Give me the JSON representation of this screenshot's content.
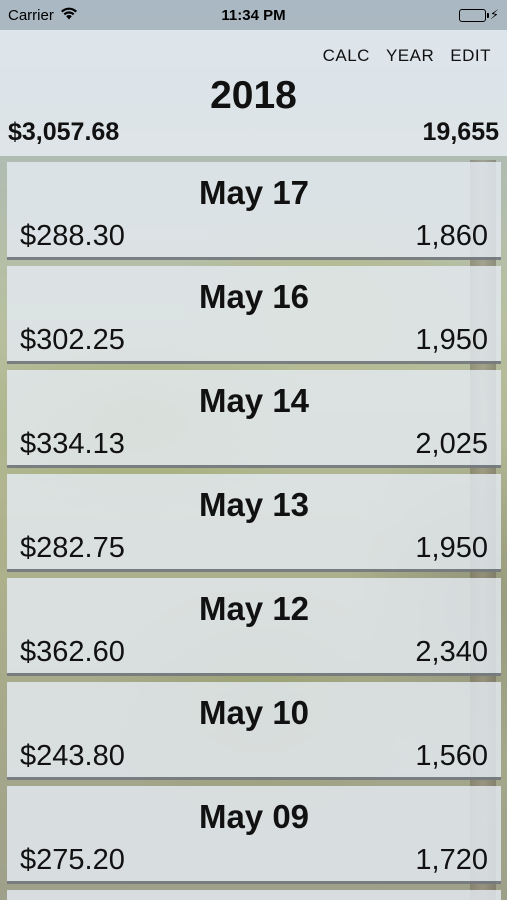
{
  "status_bar": {
    "carrier": "Carrier",
    "time": "11:34 PM",
    "wifi_icon": "wifi-icon",
    "battery_icon": "battery-icon",
    "battery_color": "#4cd964"
  },
  "header": {
    "nav": [
      {
        "label": "CALC"
      },
      {
        "label": "YEAR"
      },
      {
        "label": "EDIT"
      }
    ],
    "year": "2018",
    "total_amount": "$3,057.68",
    "total_count": "19,655"
  },
  "entries": [
    {
      "date": "May 17",
      "amount": "$288.30",
      "count": "1,860"
    },
    {
      "date": "May 16",
      "amount": "$302.25",
      "count": "1,950"
    },
    {
      "date": "May 14",
      "amount": "$334.13",
      "count": "2,025"
    },
    {
      "date": "May 13",
      "amount": "$282.75",
      "count": "1,950"
    },
    {
      "date": "May 12",
      "amount": "$362.60",
      "count": "2,340"
    },
    {
      "date": "May 10",
      "amount": "$243.80",
      "count": "1,560"
    },
    {
      "date": "May 09",
      "amount": "$275.20",
      "count": "1,720"
    }
  ]
}
